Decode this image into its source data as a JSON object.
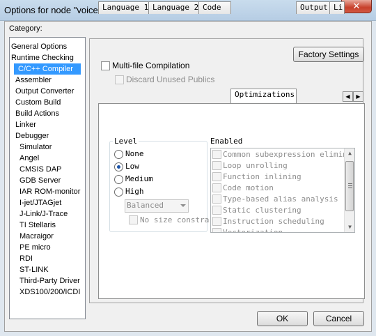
{
  "window": {
    "title": "Options for node \"voice2\"",
    "close_glyph": "✕"
  },
  "category": {
    "label": "Category:",
    "items": [
      {
        "label": "General Options",
        "level": 0,
        "selected": false
      },
      {
        "label": "Runtime Checking",
        "level": 0,
        "selected": false
      },
      {
        "label": "C/C++ Compiler",
        "level": 1,
        "selected": true
      },
      {
        "label": "Assembler",
        "level": 1,
        "selected": false
      },
      {
        "label": "Output Converter",
        "level": 1,
        "selected": false
      },
      {
        "label": "Custom Build",
        "level": 1,
        "selected": false
      },
      {
        "label": "Build Actions",
        "level": 1,
        "selected": false
      },
      {
        "label": "Linker",
        "level": 1,
        "selected": false
      },
      {
        "label": "Debugger",
        "level": 1,
        "selected": false
      },
      {
        "label": "Simulator",
        "level": 2,
        "selected": false
      },
      {
        "label": "Angel",
        "level": 2,
        "selected": false
      },
      {
        "label": "CMSIS DAP",
        "level": 2,
        "selected": false
      },
      {
        "label": "GDB Server",
        "level": 2,
        "selected": false
      },
      {
        "label": "IAR ROM-monitor",
        "level": 2,
        "selected": false
      },
      {
        "label": "I-jet/JTAGjet",
        "level": 2,
        "selected": false
      },
      {
        "label": "J-Link/J-Trace",
        "level": 2,
        "selected": false
      },
      {
        "label": "TI Stellaris",
        "level": 2,
        "selected": false
      },
      {
        "label": "Macraigor",
        "level": 2,
        "selected": false
      },
      {
        "label": "PE micro",
        "level": 2,
        "selected": false
      },
      {
        "label": "RDI",
        "level": 2,
        "selected": false
      },
      {
        "label": "ST-LINK",
        "level": 2,
        "selected": false
      },
      {
        "label": "Third-Party Driver",
        "level": 2,
        "selected": false
      },
      {
        "label": "XDS100/200/ICDI",
        "level": 2,
        "selected": false
      }
    ]
  },
  "panel": {
    "factory_settings": "Factory Settings",
    "multi_file": "Multi-file Compilation",
    "discard_unused": "Discard Unused Publics"
  },
  "tabs": [
    {
      "label": "Language 1",
      "active": false
    },
    {
      "label": "Language 2",
      "active": false
    },
    {
      "label": "Code",
      "active": false
    },
    {
      "label": "Optimizations",
      "active": true
    },
    {
      "label": "Output",
      "active": false
    },
    {
      "label": "Li",
      "active": false
    }
  ],
  "tab_scroll": {
    "left": "◀",
    "right": "▶"
  },
  "optimizations": {
    "level": {
      "title": "Level",
      "options": [
        {
          "label": "None",
          "checked": false
        },
        {
          "label": "Low",
          "checked": true
        },
        {
          "label": "Medium",
          "checked": false
        },
        {
          "label": "High",
          "checked": false
        }
      ],
      "high_mode": "Balanced",
      "no_size_constraints": "No size constra"
    },
    "enabled": {
      "title": "Enabled",
      "items": [
        "Common subexpression elimina",
        "Loop unrolling",
        "Function inlining",
        "Code motion",
        "Type-based alias analysis",
        "Static clustering",
        "Instruction scheduling",
        "Vectorization"
      ],
      "scroll_up": "▲",
      "scroll_down": "▼"
    }
  },
  "buttons": {
    "ok": "OK",
    "cancel": "Cancel"
  }
}
